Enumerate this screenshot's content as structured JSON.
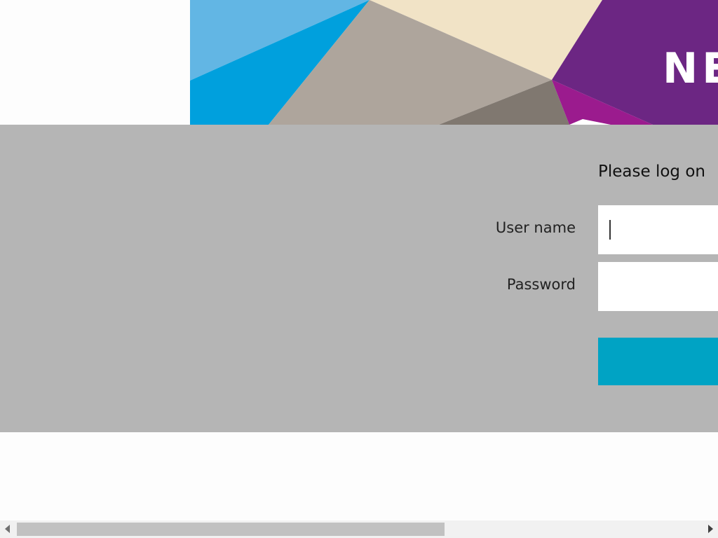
{
  "banner": {
    "brand_text": "NE",
    "colors": {
      "light_blue": "#62b6e4",
      "blue": "#00a0dd",
      "cream": "#f1e3c6",
      "taupe": "#aea59c",
      "dark_taupe": "#807870",
      "purple": "#6c2683",
      "magenta": "#9b1b8e"
    }
  },
  "login": {
    "title": "Please log on",
    "username_label": "User name",
    "username_value": "",
    "password_label": "Password",
    "password_value": "",
    "logon_button_label": ""
  },
  "colors": {
    "panel_background": "#b5b5b5",
    "button": "#00a3c4",
    "page_background": "#fdfdfd"
  },
  "scrollbar": {
    "left_icon": "scroll-left-arrow-icon",
    "right_icon": "scroll-right-arrow-icon"
  }
}
